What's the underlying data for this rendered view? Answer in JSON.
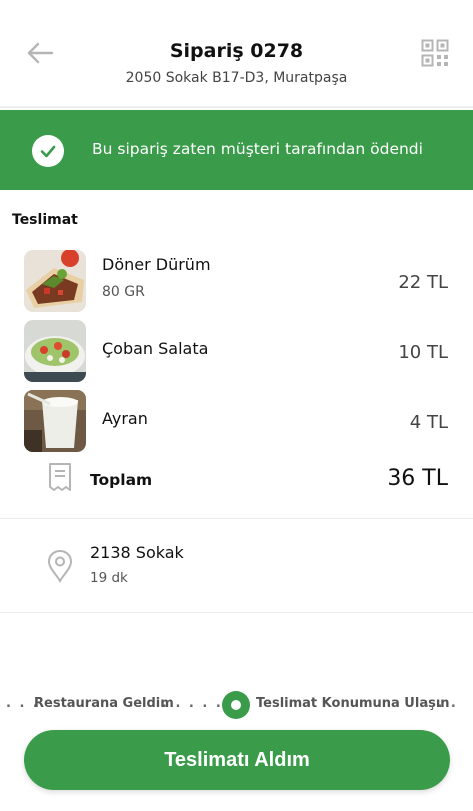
{
  "header": {
    "title": "Sipariş 0278",
    "subtitle": "2050 Sokak B17-D3, Muratpaşa"
  },
  "banner": {
    "message": "Bu sipariş zaten müşteri tarafından ödendi",
    "color": "#3a9c4a"
  },
  "section": {
    "label": "Teslimat"
  },
  "items": [
    {
      "name": "Döner Dürüm",
      "detail": "80 GR",
      "price": "22 TL",
      "image": "doner-durum"
    },
    {
      "name": "Çoban Salata",
      "detail": "",
      "price": "10 TL",
      "image": "coban-salata"
    },
    {
      "name": "Ayran",
      "detail": "",
      "price": "4 TL",
      "image": "ayran"
    }
  ],
  "total": {
    "label": "Toplam",
    "value": "36 TL"
  },
  "address": {
    "street": "2138 Sokak",
    "eta": "19 dk"
  },
  "progress": {
    "step1": "Restaurana Geldim",
    "step2": "Teslimat Konumuna Ulaşın",
    "dots_left": ". . .",
    "dots_mid": ". . . . . .",
    "dots_right": ". . ."
  },
  "cta": {
    "label": "Teslimatı Aldım"
  }
}
